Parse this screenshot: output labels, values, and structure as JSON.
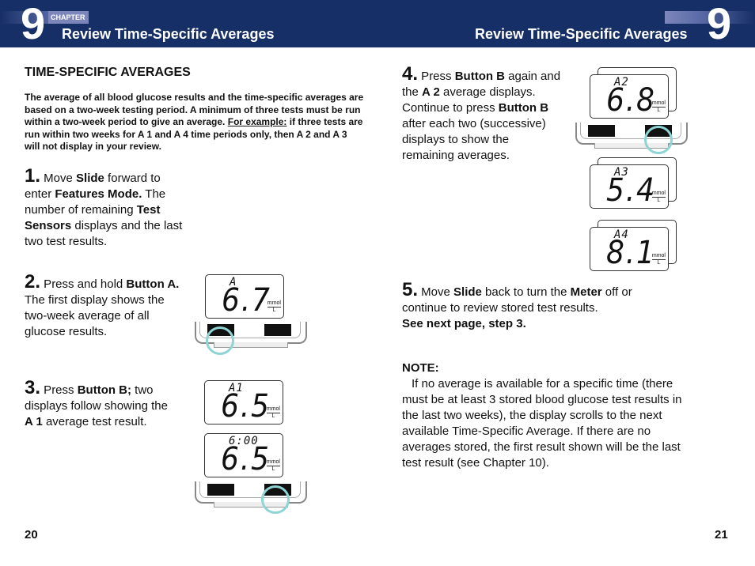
{
  "header": {
    "chapter_number_left": "9",
    "chapter_label": "CHAPTER",
    "title_left": "Review Time-Specific Averages",
    "title_right": "Review Time-Specific Averages",
    "chapter_number_right": "9"
  },
  "left_page": {
    "section_title": "TIME-SPECIFIC AVERAGES",
    "intro": {
      "part1": "The average of all blood glucose results and the time-specific averages are based on a two-week testing period. A minimum of three tests must be run within a two-week period to give an average. ",
      "example_label": "For example:",
      "part2": " if three tests are run within two weeks for A 1 and A 4 time periods only, then A 2 and A 3 will not display in your review."
    },
    "step1": {
      "num": "1.",
      "t1": " Move ",
      "b1": "Slide",
      "t2": " forward to enter ",
      "b2": "Features Mode.",
      "t3": " The number of remaining ",
      "b3": "Test Sensors",
      "t4": " displays and the last two test results."
    },
    "step2": {
      "num": "2.",
      "t1": " Press and hold ",
      "b1": "Button A.",
      "t2": " The first display shows the two-week average of all glucose results."
    },
    "step3": {
      "num": "3.",
      "t1": " Press ",
      "b1": "Button B;",
      "t2": " two displays follow showing the ",
      "b2": "A 1",
      "t3": " average test result."
    },
    "page_number": "20"
  },
  "right_page": {
    "step4": {
      "num": "4.",
      "t1": " Press ",
      "b1": "Button B",
      "t2": " again and the ",
      "b2": "A 2",
      "t3": " average displays. Continue to press ",
      "b3": "Button B",
      "t4": " after each two (successive) displays to show the remaining averages."
    },
    "step5": {
      "num": "5.",
      "t1": " Move ",
      "b1": "Slide",
      "t2": " back to turn the ",
      "b2": "Meter",
      "t3": " off or continue to review stored test results.",
      "b4": "See next page, step 3."
    },
    "note": {
      "label": "NOTE:",
      "text": "If no average is available for a specific time (there must be at least 3 stored blood glucose test results in the last two weeks), the display scrolls to the next available Time-Specific Average. If there are no averages stored, the first result shown will be the last test result (see Chapter 10)."
    },
    "page_number": "21"
  },
  "displays": [
    {
      "label": "A",
      "value": "6.7",
      "unit_top": "mmol",
      "unit_bottom": "L"
    },
    {
      "label": "A1",
      "value": "6.5",
      "unit_top": "mmol",
      "unit_bottom": "L"
    },
    {
      "label": "6:00",
      "value": "6.5",
      "unit_top": "mmol",
      "unit_bottom": "L"
    },
    {
      "label": "A2",
      "value": "6.8",
      "unit_top": "mmol",
      "unit_bottom": "L"
    },
    {
      "label": "A3",
      "value": "5.4",
      "unit_top": "mmol",
      "unit_bottom": "L"
    },
    {
      "label": "A4",
      "value": "8.1",
      "unit_top": "mmol",
      "unit_bottom": "L"
    }
  ],
  "colors": {
    "header_bg": "#162f66",
    "header_accent": "#7c86bb",
    "highlight_circle": "#8fd4d4"
  }
}
